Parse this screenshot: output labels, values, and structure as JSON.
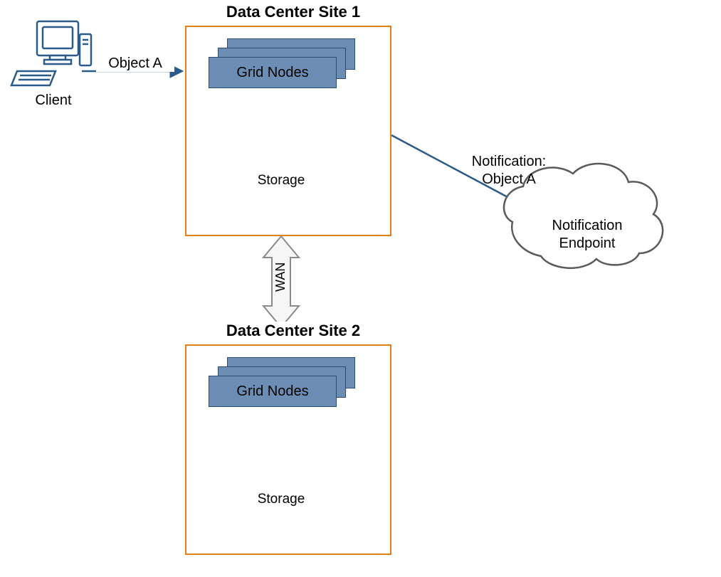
{
  "client": {
    "label": "Client"
  },
  "object": {
    "label": "Object A"
  },
  "site1": {
    "title": "Data Center Site 1",
    "gridNodes": "Grid Nodes",
    "storage": "Storage"
  },
  "site2": {
    "title": "Data Center Site 2",
    "gridNodes": "Grid Nodes",
    "storage": "Storage"
  },
  "wan": {
    "label": "WAN"
  },
  "notification": {
    "line1": "Notification:",
    "line2": "Object A",
    "endpoint1": "Notification",
    "endpoint2": "Endpoint"
  }
}
